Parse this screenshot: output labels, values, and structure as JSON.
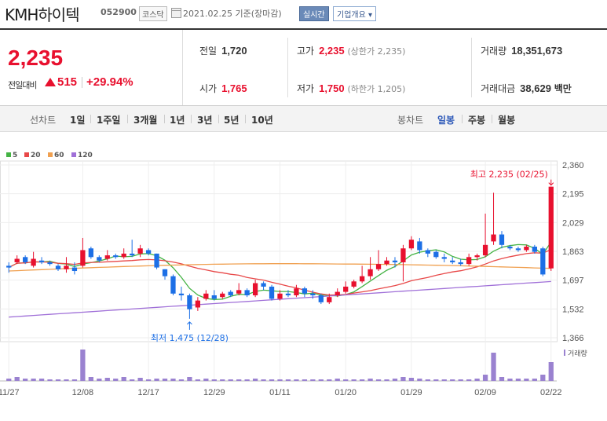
{
  "header": {
    "name": "KMH하이텍",
    "code": "052900",
    "market": "코스닥",
    "date": "2021.02.25 기준(장마감)",
    "realtime_btn": "실시간",
    "company_btn": "기업개요 ▾"
  },
  "quote": {
    "price": "2,235",
    "change_label": "전일대비",
    "change": "515",
    "change_pct": "+29.94%",
    "prev_close_label": "전일",
    "prev_close": "1,720",
    "open_label": "시가",
    "open": "1,765",
    "high_label": "고가",
    "high": "2,235",
    "upper_limit": "(상한가 2,235)",
    "low_label": "저가",
    "low": "1,750",
    "lower_limit": "(하한가 1,205)",
    "volume_label": "거래량",
    "volume": "18,351,673",
    "amount_label": "거래대금",
    "amount": "38,629",
    "amount_unit": "백만"
  },
  "periods": {
    "line_title": "선차트",
    "line_items": [
      "1일",
      "1주일",
      "3개월",
      "1년",
      "3년",
      "5년",
      "10년"
    ],
    "candle_title": "봉차트",
    "candle_items": [
      "일봉",
      "주봉",
      "월봉"
    ],
    "candle_active": "일봉"
  },
  "colors": {
    "up": "#e8102e",
    "down": "#1c6fe6",
    "ma5": "#44b344",
    "ma20": "#e84848",
    "ma60": "#f0a050",
    "ma120": "#a070d8",
    "volume": "#9a82d0"
  },
  "chart_data": {
    "type": "candlestick",
    "legend": [
      {
        "name": "5",
        "color": "#44b344"
      },
      {
        "name": "20",
        "color": "#e84848"
      },
      {
        "name": "60",
        "color": "#f0a050"
      },
      {
        "name": "120",
        "color": "#a070d8"
      }
    ],
    "y_ticks": [
      "2,360",
      "2,195",
      "2,029",
      "1,863",
      "1,697",
      "1,532",
      "1,366"
    ],
    "ylim": [
      1366,
      2360
    ],
    "x_ticks": [
      "11/27",
      "12/08",
      "12/17",
      "12/29",
      "01/11",
      "01/20",
      "01/29",
      "02/09",
      "02/22"
    ],
    "x_tick_index": [
      0,
      9,
      17,
      25,
      33,
      41,
      49,
      58,
      66
    ],
    "high_annotation": "최고 2,235 (02/25)",
    "low_annotation": "최저 1,475 (12/28)",
    "volume_label": "거래량",
    "candles": [
      [
        1780,
        1770,
        1800,
        1740
      ],
      [
        1800,
        1820,
        1840,
        1790
      ],
      [
        1830,
        1800,
        1840,
        1790
      ],
      [
        1780,
        1820,
        1860,
        1770
      ],
      [
        1810,
        1800,
        1830,
        1790
      ],
      [
        1800,
        1790,
        1810,
        1780
      ],
      [
        1780,
        1760,
        1790,
        1750
      ],
      [
        1760,
        1780,
        1830,
        1740
      ],
      [
        1770,
        1750,
        1800,
        1730
      ],
      [
        1780,
        1870,
        1940,
        1770
      ],
      [
        1880,
        1830,
        1890,
        1820
      ],
      [
        1830,
        1810,
        1840,
        1800
      ],
      [
        1820,
        1840,
        1870,
        1810
      ],
      [
        1840,
        1830,
        1850,
        1820
      ],
      [
        1830,
        1850,
        1880,
        1820
      ],
      [
        1850,
        1840,
        1930,
        1830
      ],
      [
        1850,
        1880,
        1900,
        1830
      ],
      [
        1870,
        1850,
        1880,
        1840
      ],
      [
        1850,
        1770,
        1850,
        1760
      ],
      [
        1760,
        1720,
        1760,
        1700
      ],
      [
        1720,
        1620,
        1730,
        1610
      ],
      [
        1620,
        1610,
        1660,
        1580
      ],
      [
        1610,
        1530,
        1620,
        1475
      ],
      [
        1540,
        1580,
        1600,
        1520
      ],
      [
        1590,
        1620,
        1640,
        1580
      ],
      [
        1610,
        1590,
        1640,
        1580
      ],
      [
        1600,
        1620,
        1630,
        1590
      ],
      [
        1630,
        1610,
        1640,
        1600
      ],
      [
        1620,
        1640,
        1680,
        1610
      ],
      [
        1640,
        1610,
        1650,
        1600
      ],
      [
        1610,
        1680,
        1700,
        1600
      ],
      [
        1680,
        1660,
        1690,
        1640
      ],
      [
        1660,
        1590,
        1670,
        1580
      ],
      [
        1590,
        1620,
        1640,
        1580
      ],
      [
        1620,
        1610,
        1640,
        1600
      ],
      [
        1610,
        1650,
        1670,
        1600
      ],
      [
        1650,
        1620,
        1660,
        1600
      ],
      [
        1620,
        1610,
        1640,
        1590
      ],
      [
        1610,
        1570,
        1620,
        1560
      ],
      [
        1570,
        1600,
        1620,
        1560
      ],
      [
        1610,
        1630,
        1650,
        1600
      ],
      [
        1630,
        1660,
        1690,
        1620
      ],
      [
        1660,
        1690,
        1700,
        1650
      ],
      [
        1690,
        1720,
        1780,
        1680
      ],
      [
        1720,
        1760,
        1830,
        1700
      ],
      [
        1760,
        1790,
        1870,
        1750
      ],
      [
        1790,
        1810,
        1830,
        1780
      ],
      [
        1810,
        1800,
        1830,
        1770
      ],
      [
        1800,
        1880,
        1900,
        1690
      ],
      [
        1880,
        1930,
        1950,
        1870
      ],
      [
        1920,
        1870,
        1940,
        1850
      ],
      [
        1870,
        1850,
        1880,
        1830
      ],
      [
        1860,
        1830,
        1870,
        1820
      ],
      [
        1830,
        1820,
        1850,
        1800
      ],
      [
        1810,
        1800,
        1830,
        1790
      ],
      [
        1800,
        1790,
        1820,
        1780
      ],
      [
        1790,
        1830,
        1850,
        1780
      ],
      [
        1830,
        1840,
        1850,
        1810
      ],
      [
        1840,
        1900,
        2080,
        1830
      ],
      [
        1920,
        1960,
        2200,
        1900
      ],
      [
        1960,
        1900,
        1980,
        1880
      ],
      [
        1890,
        1880,
        1900,
        1870
      ],
      [
        1880,
        1870,
        1890,
        1860
      ],
      [
        1870,
        1890,
        1900,
        1860
      ],
      [
        1890,
        1860,
        1900,
        1850
      ],
      [
        1880,
        1730,
        1890,
        1720
      ],
      [
        1765,
        2235,
        2235,
        1750
      ]
    ],
    "volume": [
      3,
      5,
      3,
      3,
      3,
      2,
      2,
      2,
      2,
      40,
      5,
      3,
      4,
      3,
      5,
      2,
      4,
      2,
      3,
      3,
      3,
      2,
      5,
      2,
      3,
      2,
      2,
      2,
      2,
      2,
      3,
      2,
      2,
      2,
      2,
      2,
      2,
      2,
      2,
      2,
      3,
      2,
      2,
      2,
      3,
      2,
      2,
      3,
      5,
      4,
      3,
      2,
      2,
      2,
      2,
      2,
      2,
      3,
      8,
      36,
      5,
      3,
      3,
      3,
      3,
      8,
      24
    ]
  }
}
